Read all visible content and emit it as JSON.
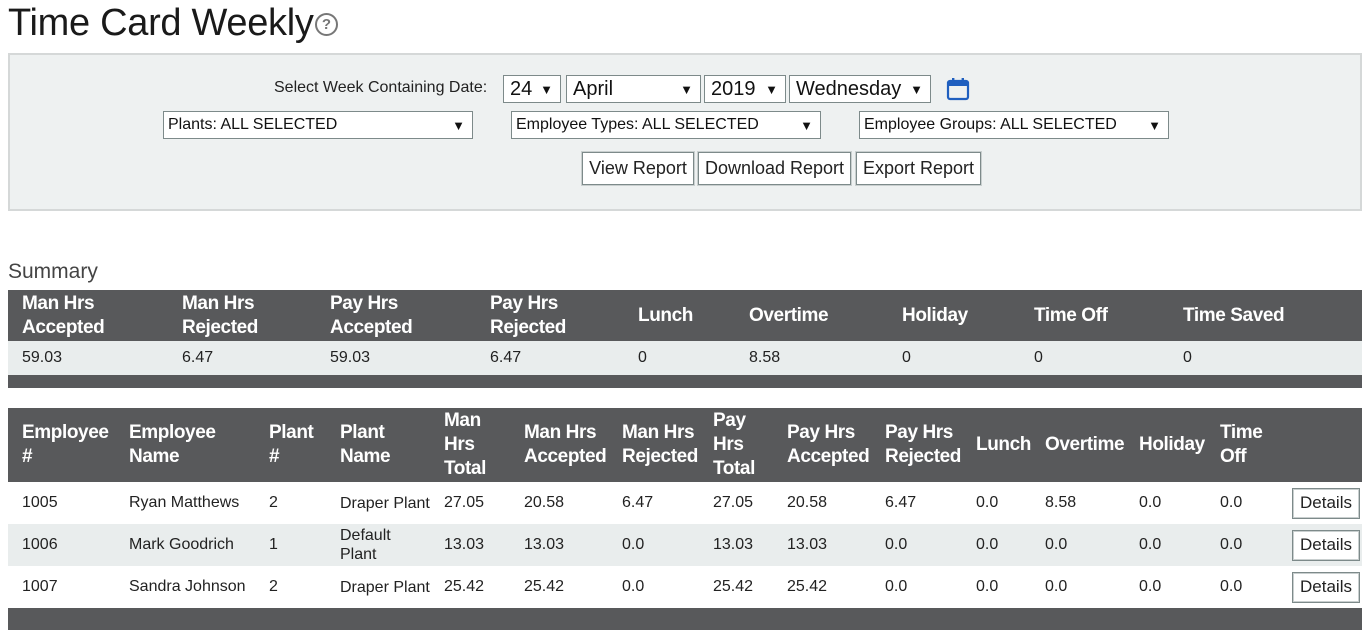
{
  "page": {
    "title": "Time Card Weekly",
    "help_icon": "question-circle-icon"
  },
  "filters": {
    "date_label": "Select Week Containing Date:",
    "day": "24",
    "month": "April",
    "year": "2019",
    "weekday": "Wednesday",
    "calendar_icon": "calendar-icon",
    "plants": "Plants: ALL SELECTED",
    "employee_types": "Employee Types: ALL SELECTED",
    "employee_groups": "Employee Groups: ALL SELECTED",
    "caret": "▼",
    "view_report": "View Report",
    "download_report": "Download Report",
    "export_report": "Export Report"
  },
  "summary": {
    "label": "Summary",
    "headers": [
      "Man Hrs Accepted",
      "Man Hrs Rejected",
      "Pay Hrs Accepted",
      "Pay Hrs Rejected",
      "Lunch",
      "Overtime",
      "Holiday",
      "Time Off",
      "Time Saved"
    ],
    "values": [
      "59.03",
      "6.47",
      "59.03",
      "6.47",
      "0",
      "8.58",
      "0",
      "0",
      "0"
    ]
  },
  "employees": {
    "headers": [
      "Employee #",
      "Employee Name",
      "Plant #",
      "Plant Name",
      "Man Hrs Total",
      "Man Hrs Accepted",
      "Man Hrs Rejected",
      "Pay Hrs Total",
      "Pay Hrs Accepted",
      "Pay Hrs Rejected",
      "Lunch",
      "Overtime",
      "Holiday",
      "Time Off"
    ],
    "details_label": "Details",
    "rows": [
      [
        "1005",
        "Ryan Matthews",
        "2",
        "Draper Plant",
        "27.05",
        "20.58",
        "6.47",
        "27.05",
        "20.58",
        "6.47",
        "0.0",
        "8.58",
        "0.0",
        "0.0"
      ],
      [
        "1006",
        "Mark Goodrich",
        "1",
        "Default Plant",
        "13.03",
        "13.03",
        "0.0",
        "13.03",
        "13.03",
        "0.0",
        "0.0",
        "0.0",
        "0.0",
        "0.0"
      ],
      [
        "1007",
        "Sandra Johnson",
        "2",
        "Draper Plant",
        "25.42",
        "25.42",
        "0.0",
        "25.42",
        "25.42",
        "0.0",
        "0.0",
        "0.0",
        "0.0",
        "0.0"
      ]
    ]
  }
}
